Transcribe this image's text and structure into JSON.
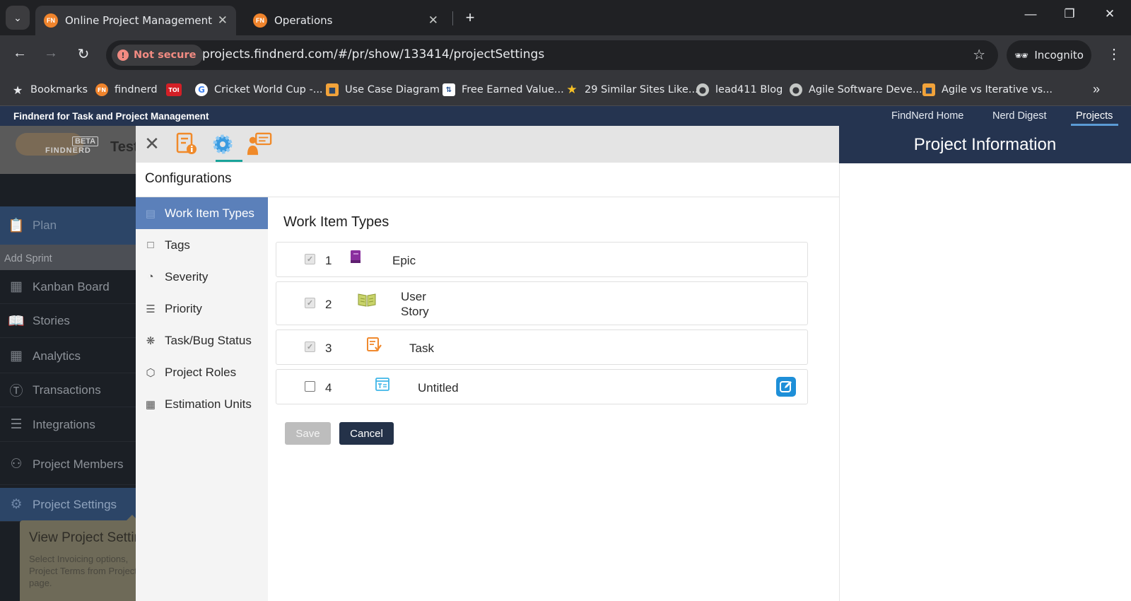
{
  "browser": {
    "tabs": [
      {
        "title": "Online Project Management To",
        "favicon": "FN",
        "active": true
      },
      {
        "title": "Operations",
        "favicon": "FN",
        "active": false
      }
    ],
    "security_label": "Not secure",
    "url": "projects.findnerd.com/#/pr/show/133414/projectSettings",
    "incognito_label": "Incognito",
    "bookmarks": [
      {
        "label": "Bookmarks",
        "icon": "star-icon"
      },
      {
        "label": "findnerd",
        "icon": "findnerd-favicon"
      },
      {
        "label": "",
        "icon": "toi-favicon",
        "badge": "TOI"
      },
      {
        "label": "Cricket World Cup -...",
        "icon": "google-favicon"
      },
      {
        "label": "Use Case Diagram",
        "icon": "shield-favicon"
      },
      {
        "label": "Free Earned Value...",
        "icon": "chart-favicon"
      },
      {
        "label": "29 Similar Sites Like...",
        "icon": "star-favicon"
      },
      {
        "label": "lead411 Blog",
        "icon": "globe-icon"
      },
      {
        "label": "Agile Software Deve...",
        "icon": "globe-icon"
      },
      {
        "label": "Agile vs Iterative vs...",
        "icon": "shield-favicon"
      }
    ]
  },
  "app": {
    "title": "Findnerd for Task and Project Management",
    "nav": [
      {
        "label": "FindNerd Home"
      },
      {
        "label": "Nerd Digest"
      },
      {
        "label": "Projects",
        "active": true
      }
    ],
    "logo_text": "FINDNERD",
    "beta_label": "BETA",
    "project_title_fragment": "Test"
  },
  "sidebar": {
    "plan_label": "Plan",
    "add_sprint_label": "Add Sprint",
    "items": [
      {
        "label": "Kanban Board",
        "icon": "kanban-icon"
      },
      {
        "label": "Stories",
        "icon": "book-icon"
      },
      {
        "label": "Analytics",
        "icon": "analytics-icon"
      },
      {
        "label": "Transactions",
        "icon": "dollar-icon"
      },
      {
        "label": "Integrations",
        "icon": "layers-icon"
      },
      {
        "label": "Project Members",
        "icon": "members-icon"
      },
      {
        "label": "Project Settings",
        "icon": "gear-icon",
        "active": true
      }
    ],
    "tooltip": {
      "title": "View Project Settings",
      "body": "Select Invoicing options, Project Terms from Project page."
    }
  },
  "modal": {
    "section_title": "Configurations",
    "nav": [
      {
        "label": "Work Item Types",
        "icon": "list-icon",
        "active": true
      },
      {
        "label": "Tags",
        "icon": "tag-icon"
      },
      {
        "label": "Severity",
        "icon": "gauge-icon"
      },
      {
        "label": "Priority",
        "icon": "checklist-icon"
      },
      {
        "label": "Task/Bug Status",
        "icon": "bug-icon"
      },
      {
        "label": "Project Roles",
        "icon": "cube-icon"
      },
      {
        "label": "Estimation Units",
        "icon": "table-icon"
      }
    ],
    "content_title": "Work Item Types",
    "work_items": [
      {
        "num": "1",
        "name": "Epic",
        "checked": true,
        "icon": "epic-book-icon",
        "color": "#8a2f9e"
      },
      {
        "num": "2",
        "name": "User Story",
        "checked": true,
        "icon": "open-book-icon",
        "color": "#a7b54a"
      },
      {
        "num": "3",
        "name": "Task",
        "checked": true,
        "icon": "task-icon",
        "color": "#f0892d"
      },
      {
        "num": "4",
        "name": "Untitled",
        "checked": false,
        "icon": "text-card-icon",
        "color": "#3fb6e8"
      }
    ],
    "save_label": "Save",
    "cancel_label": "Cancel"
  },
  "info_panel": {
    "title": "Project Information"
  },
  "colors": {
    "header_navy": "#253450",
    "active_nav_blue": "#5b80ba",
    "teal_accent": "#1aa39a",
    "edit_blue": "#1e8fd8"
  }
}
